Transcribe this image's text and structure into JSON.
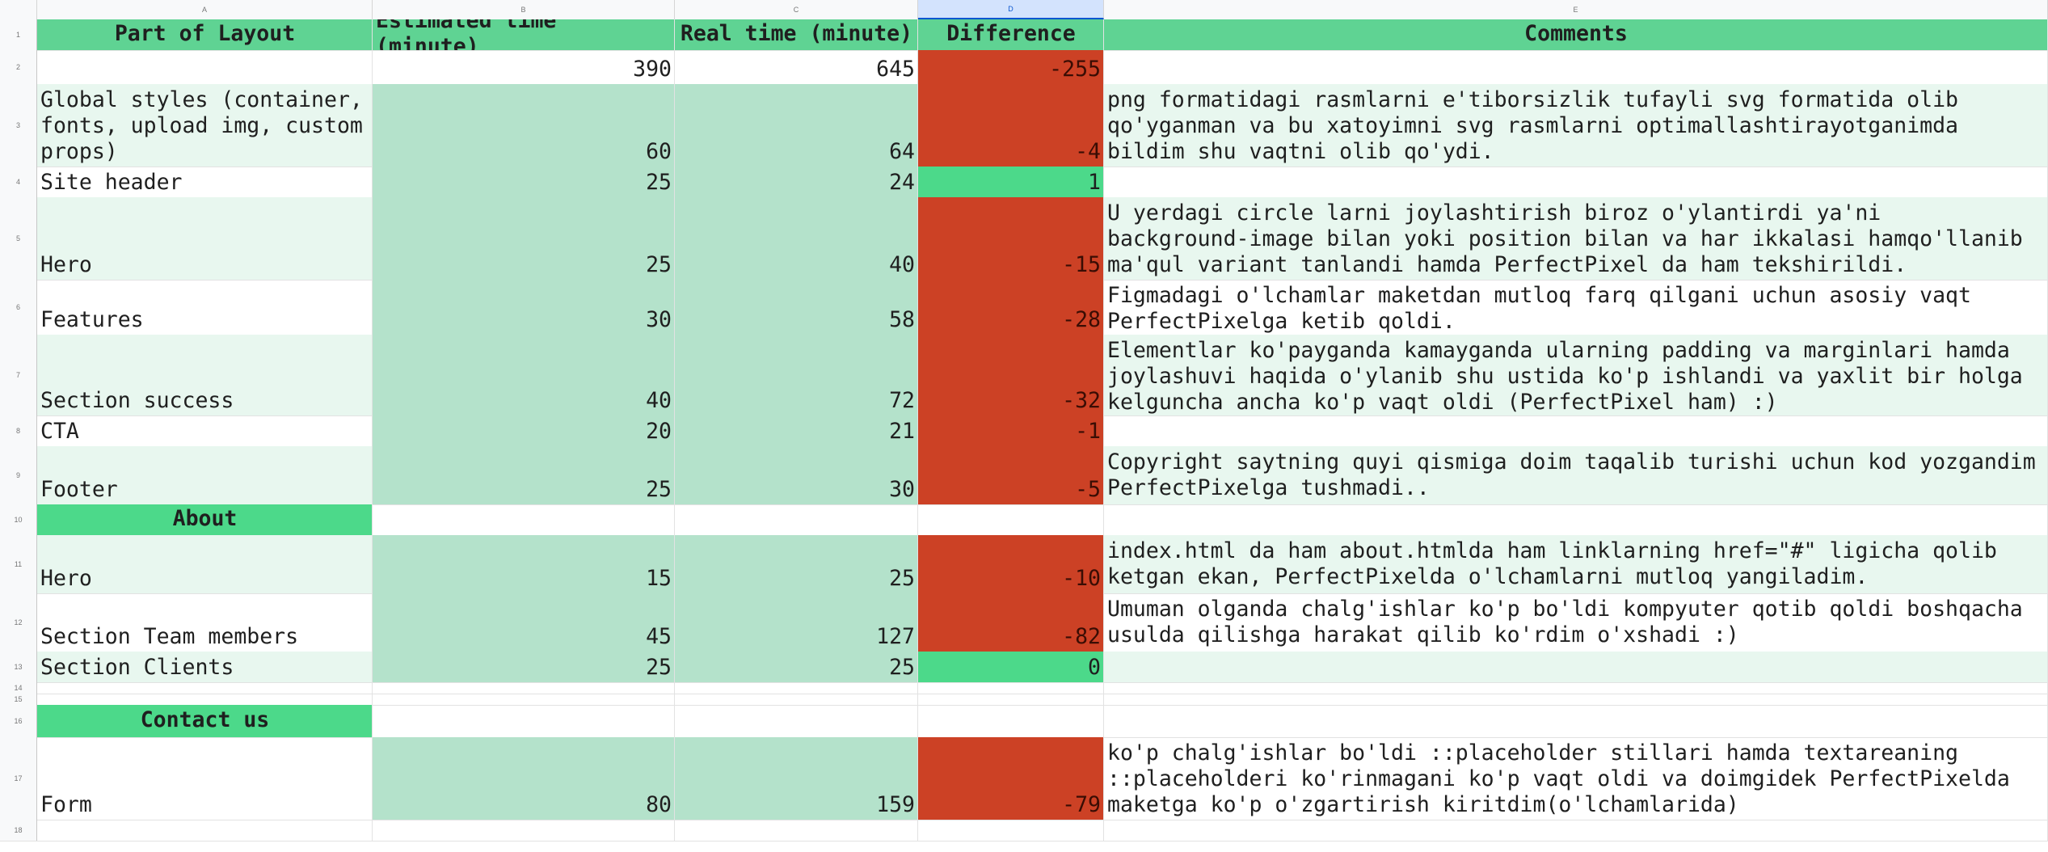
{
  "columns": [
    "A",
    "B",
    "C",
    "D",
    "E"
  ],
  "header": {
    "part": "Part of Layout",
    "estimated": "Estimated time (minute)",
    "real": "Real time (minute)",
    "difference": "Difference",
    "comments": "Comments"
  },
  "totals": {
    "row": "2",
    "estimated": "390",
    "real": "645",
    "difference": "-255"
  },
  "rows": [
    {
      "row": "3",
      "part": "Global styles (container,\nfonts, upload img, custom\nprops)",
      "estimated": "60",
      "real": "64",
      "difference": "-4",
      "comment": "png formatidagi rasmlarni e'tiborsizlik tufayli svg formatida olib\nqo'yganman va bu xatoyimni svg rasmlarni optimallashtirayotganimda\nbildim shu vaqtni olib qo'ydi."
    },
    {
      "row": "4",
      "part": "Site header",
      "estimated": "25",
      "real": "24",
      "difference": "1",
      "comment": ""
    },
    {
      "row": "5",
      "part": "Hero",
      "estimated": "25",
      "real": "40",
      "difference": "-15",
      "comment": "U yerdagi circle larni joylashtirish biroz o'ylantirdi ya'ni\nbackground-image bilan yoki position bilan va har ikkalasi hamqo'llanib\nma'qul variant tanlandi hamda PerfectPixel da ham tekshirildi."
    },
    {
      "row": "6",
      "part": "Features",
      "estimated": "30",
      "real": "58",
      "difference": "-28",
      "comment": "Figmadagi o'lchamlar maketdan mutloq farq qilgani uchun asosiy vaqt\nPerfectPixelga ketib qoldi."
    },
    {
      "row": "7",
      "part": "Section success",
      "estimated": "40",
      "real": "72",
      "difference": "-32",
      "comment": "Elementlar ko'payganda kamayganda ularning padding va marginlari hamda\njoylashuvi haqida o'ylanib shu ustida ko'p ishlandi va yaxlit bir holga\nkelguncha ancha ko'p vaqt oldi (PerfectPixel ham) :)"
    },
    {
      "row": "8",
      "part": "CTA",
      "estimated": "20",
      "real": "21",
      "difference": "-1",
      "comment": ""
    },
    {
      "row": "9",
      "part": "Footer",
      "estimated": "25",
      "real": "30",
      "difference": "-5",
      "comment": "Copyright saytning quyi qismiga doim taqalib turishi uchun kod yozgandim\nPerfectPixelga tushmadi.."
    },
    {
      "row": "10",
      "section": "About"
    },
    {
      "row": "11",
      "part": "Hero",
      "estimated": "15",
      "real": "25",
      "difference": "-10",
      "comment": "index.html da ham about.htmlda ham linklarning href=\"#\" ligicha qolib\nketgan ekan, PerfectPixelda o'lchamlarni mutloq yangiladim."
    },
    {
      "row": "12",
      "part": "Section Team members",
      "estimated": "45",
      "real": "127",
      "difference": "-82",
      "comment": "Umuman olganda chalg'ishlar ko'p bo'ldi kompyuter qotib qoldi boshqacha\nusulda qilishga harakat qilib ko'rdim o'xshadi :)"
    },
    {
      "row": "13",
      "part": "Section Clients",
      "estimated": "25",
      "real": "25",
      "difference": "0",
      "comment": ""
    },
    {
      "row": "14"
    },
    {
      "row": "15"
    },
    {
      "row": "16",
      "section": "Contact us"
    },
    {
      "row": "17",
      "part": "Form",
      "estimated": "80",
      "real": "159",
      "difference": "-79",
      "comment": "ko'p chalg'ishlar bo'ldi ::placeholder stillari hamda textareaning\n::placeholderi ko'rinmagani ko'p vaqt oldi va doimgidek PerfectPixelda\nmaketga ko'p o'zgartirish kiritdim(o'lchamlarida)"
    },
    {
      "row": "18"
    }
  ],
  "colors": {
    "header": "#5fd393",
    "negative": "#cc4125",
    "positive": "#4cd98a",
    "estimated": "#b4e2cb",
    "band": "#e8f7ef"
  }
}
